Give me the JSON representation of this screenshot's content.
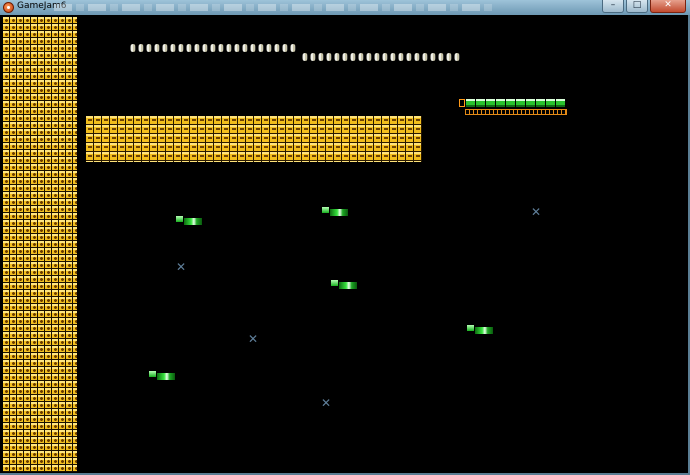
{
  "window": {
    "title": "GameJam6",
    "min_glyph": "–",
    "max_glyph": "□",
    "close_glyph": "✕"
  },
  "markers": {
    "glyph": "✕"
  }
}
